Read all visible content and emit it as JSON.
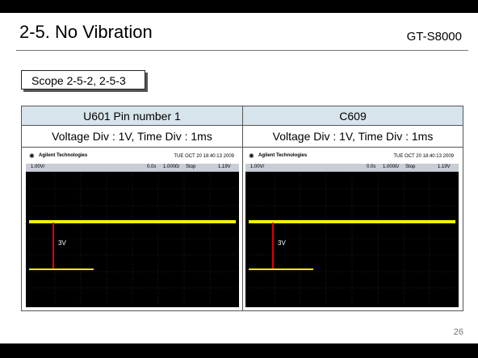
{
  "header": {
    "title": "2-5. No Vibration",
    "model": "GT-S8000"
  },
  "scope_label": "Scope 2-5-2, 2-5-3",
  "table": {
    "col1": {
      "header": "U601 Pin number 1",
      "settings": "Voltage Div : 1V, Time Div : 1ms"
    },
    "col2": {
      "header": "C609",
      "settings": "Voltage Div : 1V, Time Div : 1ms"
    }
  },
  "scope1": {
    "brand": "Agilent Technologies",
    "timestamp": "TUE OCT 20 18:40:13 2009",
    "status": {
      "ch1": "1.00V/",
      "delay": "0.0s",
      "timebase": "1.000ß/",
      "mode": "Stop",
      "level": "1.19V"
    },
    "marker_label": "3V"
  },
  "scope2": {
    "brand": "Agilent Technologies",
    "timestamp": "TUE OCT 20 18:40:13 2009",
    "status": {
      "ch1": "1.00V/",
      "delay": "0.0s",
      "timebase": "1.000ß/",
      "mode": "Stop",
      "level": "1.19V"
    },
    "marker_label": "3V"
  },
  "page_number": "26",
  "colors": {
    "trace": "#f5f200",
    "marker": "#e00000",
    "header_bg": "#d8e4ec"
  }
}
